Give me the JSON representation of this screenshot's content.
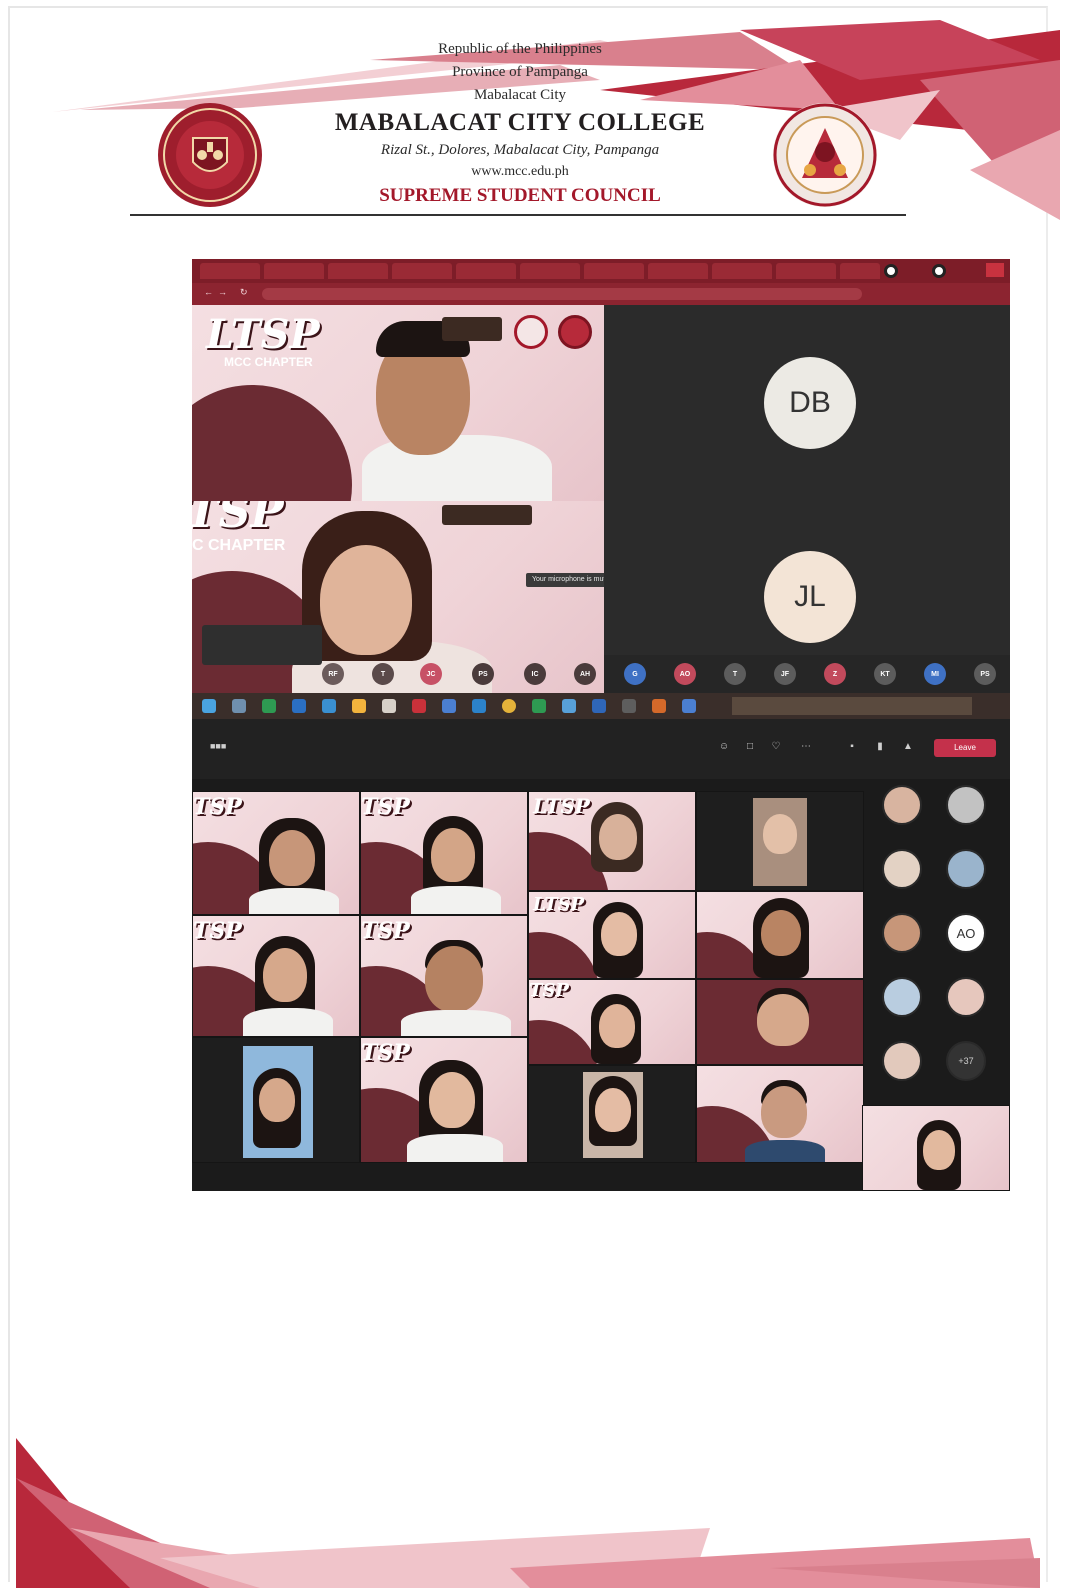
{
  "letterhead": {
    "line1": "Republic of the Philippines",
    "line2": "Province of Pampanga",
    "line3": "Mabalacat City",
    "college": "MABALACAT CITY COLLEGE",
    "address": "Rizal St., Dolores, Mabalacat City, Pampanga",
    "website": "www.mcc.edu.ph",
    "council": "SUPREME STUDENT COUNCIL"
  },
  "logos": {
    "left": "mcc-seal",
    "right": "ssc-seal"
  },
  "colors": {
    "accent": "#a3182a",
    "deco_red": "#b8283b",
    "deco_pink": "#e9a7b0"
  },
  "meet": {
    "ltsp_text": "LTSP",
    "chapter_text": "MCC CHAPTER",
    "chapter_text_cropped": "C CHAPTER",
    "ltsp_cropped": "TSP",
    "avatar_db": "DB",
    "avatar_jl": "JL",
    "mute_notice": "Your microphone is muted",
    "strip_bubbles": [
      "RF",
      "T",
      "JC",
      "PS",
      "IC",
      "AH",
      "G",
      "AO",
      "T",
      "JF",
      "Z",
      "KT",
      "MI",
      "PS"
    ]
  },
  "teams": {
    "leave_label": "Leave",
    "sidebar_badge": "AO",
    "more_count": "+37"
  }
}
